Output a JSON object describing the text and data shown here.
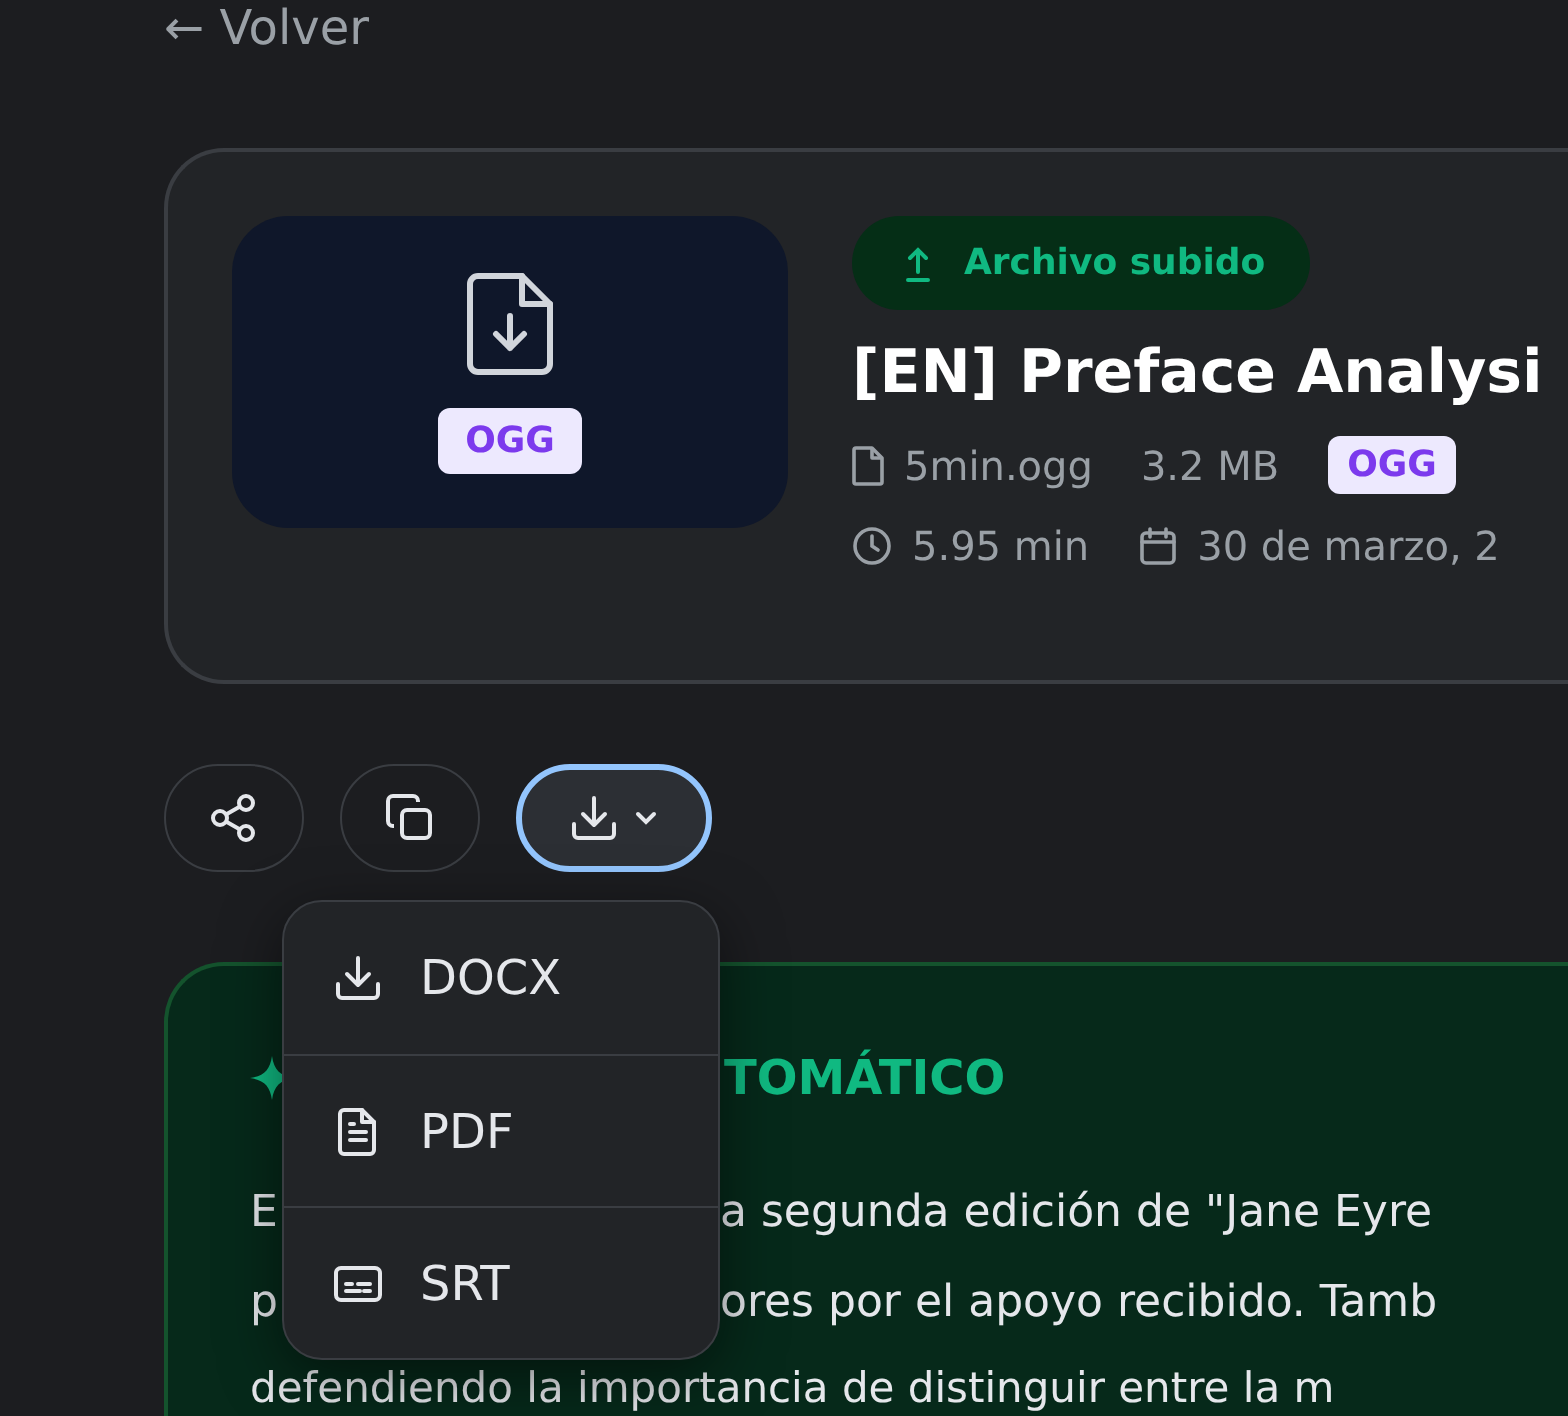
{
  "back_link": {
    "arrow": "←",
    "label": "Volver"
  },
  "file_card": {
    "thumbnail_badge": "OGG",
    "status_badge": "Archivo subido",
    "title": "[EN] Preface Analysi",
    "filename": "5min.ogg",
    "size": "3.2 MB",
    "format_badge": "OGG",
    "duration": "5.95 min",
    "date": "30 de marzo, 2"
  },
  "actions": [
    {
      "kind": "share"
    },
    {
      "kind": "copy"
    },
    {
      "kind": "download",
      "expanded": true
    }
  ],
  "download_menu": [
    {
      "kind": "docx",
      "label": "DOCX"
    },
    {
      "kind": "pdf",
      "label": "PDF"
    },
    {
      "kind": "srt",
      "label": "SRT"
    }
  ],
  "summary": {
    "title": "TOMÁTICO",
    "lines": [
      {
        "start": "E",
        "rest": "a segunda edición de \"Jane Eyre"
      },
      {
        "start": "p",
        "rest": "ores por el apoyo recibido. Tamb"
      },
      {
        "start": "defendiendo la importancia de distinguir entre la m"
      }
    ]
  }
}
